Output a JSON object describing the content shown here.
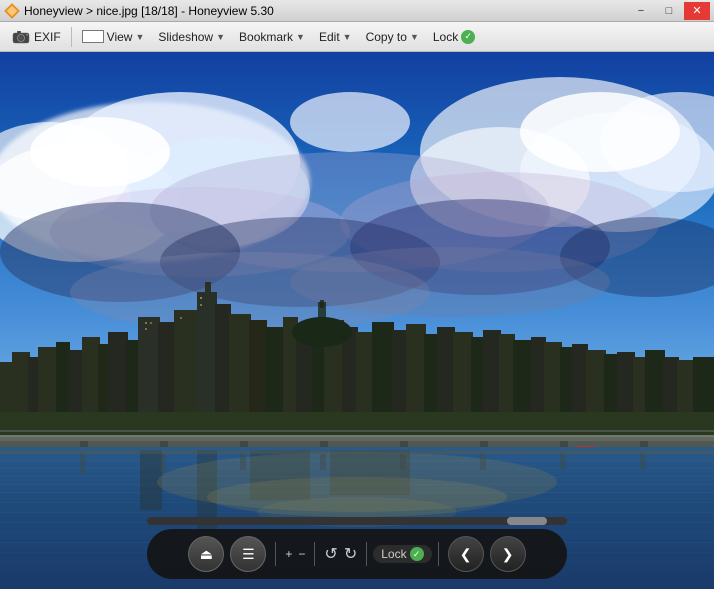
{
  "titlebar": {
    "app_name": "Honeyview",
    "separator1": ">",
    "filename": "nice.jpg [18/18]",
    "separator2": "-",
    "app_version": "Honeyview 5.30",
    "full_title": "Honeyview > nice.jpg [18/18] - Honeyview 5.30",
    "minimize_label": "−",
    "restore_label": "□",
    "close_label": "✕"
  },
  "toolbar": {
    "exif_label": "EXIF",
    "view_label": "View",
    "slideshow_label": "Slideshow",
    "bookmark_label": "Bookmark",
    "edit_label": "Edit",
    "copyto_label": "Copy to",
    "lock_label": "Lock"
  },
  "controls": {
    "eject_icon": "⏏",
    "menu_icon": "☰",
    "zoom_in": "+",
    "zoom_out": "−",
    "rotate_left": "↺",
    "rotate_right": "↻",
    "lock_label": "Lock",
    "prev_icon": "❮",
    "next_icon": "❯"
  },
  "image": {
    "alt": "Cityscape at sunset with river and bridge",
    "sky_color_top": "#1a6bbf",
    "sky_color_mid": "#5b9fd4",
    "sky_color_sunset": "#c8a84b",
    "water_color": "#2a7abf",
    "city_color": "#2a3a2a"
  }
}
